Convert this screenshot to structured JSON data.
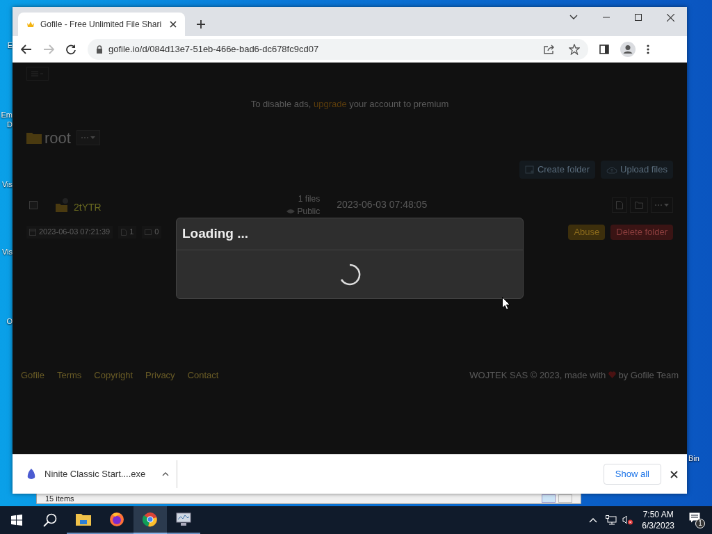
{
  "desktop": {
    "icon_labels": [
      [
        "E"
      ],
      [
        "Em",
        "D"
      ],
      [
        "Vis"
      ],
      [
        "Vis"
      ],
      [
        "O"
      ],
      [
        "Bin"
      ]
    ],
    "background_window": {
      "status": "15 items"
    }
  },
  "browser": {
    "tab": {
      "title": "Gofile - Free Unlimited File Shari",
      "selected": true
    },
    "address": "gofile.io/d/084d13e7-51eb-466e-bad6-dc678fc9cd07",
    "page": {
      "banner": {
        "before": "To disable ads, ",
        "link": "upgrade",
        "after": " your account to premium"
      },
      "folder_title": "root",
      "actions": [
        "Create folder",
        "Upload files"
      ],
      "item": {
        "checked": false,
        "name": "2tYTR",
        "count": "1 files",
        "visibility": "Public",
        "date": "2023-06-03 07:48:05",
        "created": "2023-06-03 07:21:39",
        "files": "1",
        "size": "0",
        "buttons": [
          {
            "label": "Abuse",
            "kind": "warning"
          },
          {
            "label": "Delete folder",
            "kind": "danger"
          }
        ]
      },
      "footer_links": [
        "Gofile",
        "Terms",
        "Copyright",
        "Privacy",
        "Contact"
      ],
      "footer_credit": {
        "before": "WOJTEK SAS © 2023, made with ",
        "after": " by Gofile Team"
      }
    },
    "modal": {
      "title": "Loading ..."
    },
    "downloads": {
      "file": "Ninite Classic Start....exe",
      "show_all": "Show all"
    }
  },
  "taskbar": {
    "apps": [
      {
        "kind": "explorer",
        "selected": false
      },
      {
        "kind": "firefox",
        "selected": false
      },
      {
        "kind": "chrome",
        "selected": true
      },
      {
        "kind": "monitor",
        "selected": false
      }
    ],
    "time": "7:50 AM",
    "date": "6/3/2023",
    "notifications": "1"
  }
}
